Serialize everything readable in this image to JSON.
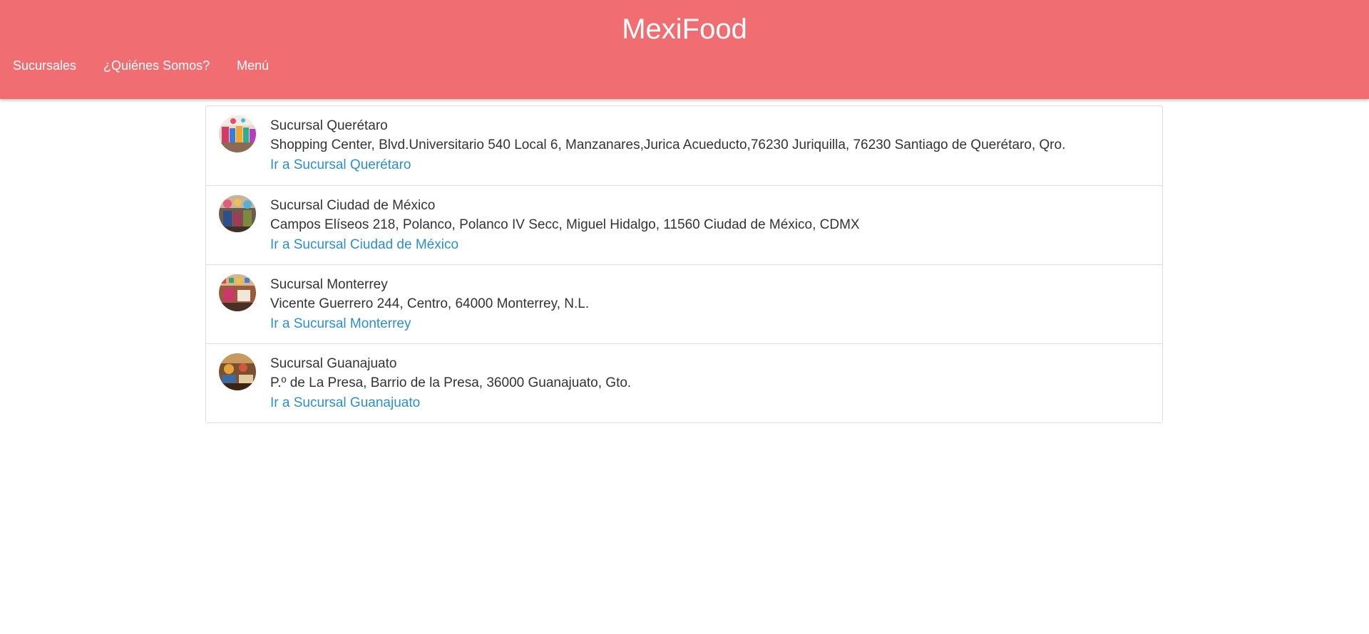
{
  "brand": "MexiFood",
  "nav": {
    "items": [
      {
        "label": "Sucursales"
      },
      {
        "label": "¿Quiénes Somos?"
      },
      {
        "label": "Menú"
      }
    ]
  },
  "branches": [
    {
      "title": "Sucursal Querétaro",
      "address": "Shopping Center, Blvd.Universitario 540 Local 6, Manzanares,Jurica Acueducto,76230 Juriquilla, 76230 Santiago de Querétaro, Qro.",
      "link": "Ir a Sucursal Querétaro"
    },
    {
      "title": "Sucursal Ciudad de México",
      "address": "Campos Elíseos 218, Polanco, Polanco IV Secc, Miguel Hidalgo, 11560 Ciudad de México, CDMX",
      "link": "Ir a Sucursal Ciudad de México"
    },
    {
      "title": "Sucursal Monterrey",
      "address": "Vicente Guerrero 244, Centro, 64000 Monterrey, N.L.",
      "link": "Ir a Sucursal Monterrey"
    },
    {
      "title": "Sucursal Guanajuato",
      "address": "P.º de La Presa, Barrio de la Presa, 36000 Guanajuato, Gto.",
      "link": "Ir a Sucursal Guanajuato"
    }
  ],
  "colors": {
    "navbar": "#f06e72",
    "link": "#2a8fcf"
  }
}
